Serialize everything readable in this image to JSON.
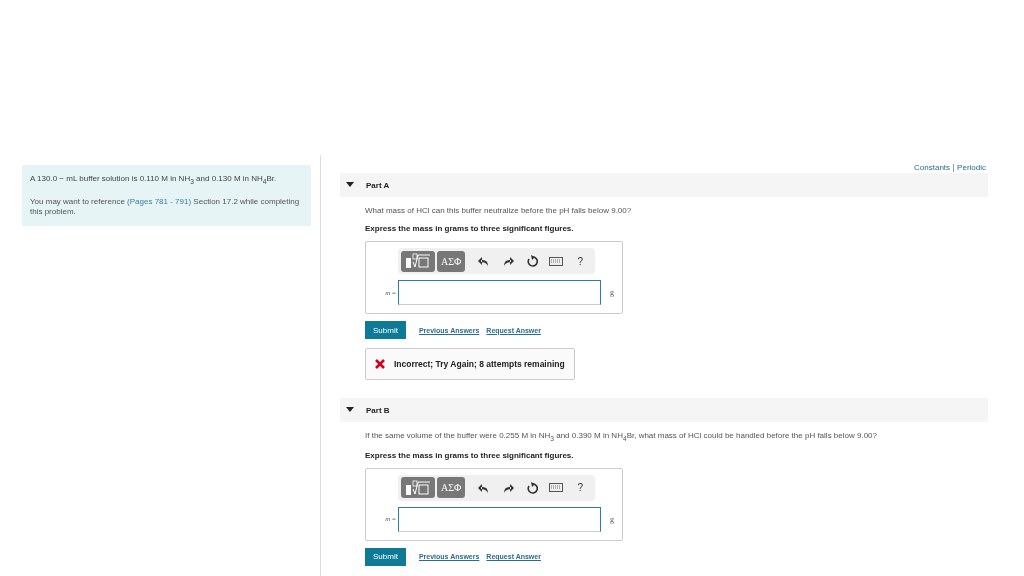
{
  "problem": {
    "statement": "A 130.0 − mL buffer solution is 0.110 M in NH$_{3}$ and 0.130 M in NH$_{4}$Br.",
    "reference": {
      "before": "You may want to reference",
      "link": "(Pages 781 - 791)",
      "after": "Section 17.2 while completing this problem."
    }
  },
  "header_links": [
    "Constants",
    "Periodic"
  ],
  "parts": [
    {
      "title": "Part A",
      "expanded": true,
      "question": "What mass of HCl can this buffer neutralize before the pH falls below 9.00?",
      "instruction": "Express the mass in grams to three significant figures.",
      "toolbar": {
        "symbols": "ΑΣΦ",
        "help": "?"
      },
      "answer": {
        "label": "*m* =",
        "unit": "g"
      },
      "submit": "Submit",
      "links": [
        "Previous Answers",
        "Request Answer"
      ],
      "feedback": {
        "kind": "incorrect",
        "text": "Incorrect; Try Again; 8 attempts remaining"
      }
    },
    {
      "title": "Part B",
      "expanded": true,
      "question": "If the same volume of the buffer were 0.255 M in NH$_{3}$ and 0.390 M in NH$_{4}$Br, what mass of HCl could be handled before the pH falls below 9.00?",
      "instruction": "Express the mass in grams to three significant figures.",
      "toolbar": {
        "symbols": "ΑΣΦ",
        "help": "?"
      },
      "answer": {
        "label": "*m* =",
        "unit": "g"
      },
      "submit": "Submit",
      "links": [
        "Previous Answers",
        "Request Answer"
      ]
    }
  ]
}
